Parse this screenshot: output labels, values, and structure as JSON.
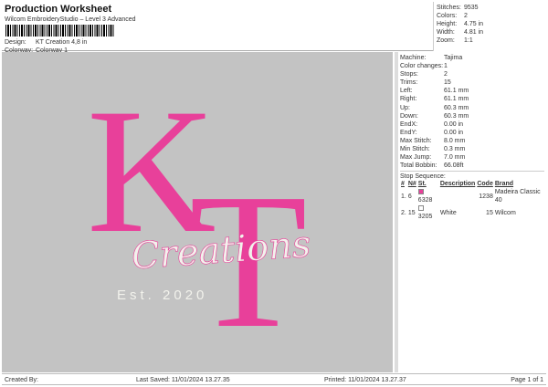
{
  "header": {
    "title": "Production Worksheet",
    "subtitle": "Wilcom EmbroideryStudio – Level 3 Advanced",
    "design_label": "Design:",
    "design": "KT Creation 4,8 in",
    "colorway_label": "Colorway:",
    "colorway": "Colorway 1"
  },
  "stats": [
    {
      "k": "Stitches:",
      "v": "9535"
    },
    {
      "k": "Colors:",
      "v": "2"
    },
    {
      "k": "Height:",
      "v": "4.75 in"
    },
    {
      "k": "Width:",
      "v": "4.81 in"
    },
    {
      "k": "Zoom:",
      "v": "1:1"
    }
  ],
  "design_art": {
    "initials_k": "K",
    "initials_t": "T",
    "script": "Creations",
    "est": "Est. 2020",
    "colors": {
      "pink": "#e8409a",
      "white": "#f2f2ec",
      "background": "#c3c3c3"
    }
  },
  "info": [
    {
      "k": "Machine:",
      "v": "Tajima"
    },
    {
      "k": "Color changes:",
      "v": "1"
    },
    {
      "k": "Stops:",
      "v": "2"
    },
    {
      "k": "Trims:",
      "v": "15"
    },
    {
      "k": "Left:",
      "v": "61.1 mm"
    },
    {
      "k": "Right:",
      "v": "61.1 mm"
    },
    {
      "k": "Up:",
      "v": "60.3 mm"
    },
    {
      "k": "Down:",
      "v": "60.3 mm"
    },
    {
      "k": "EndX:",
      "v": "0.00 in"
    },
    {
      "k": "EndY:",
      "v": "0.00 in"
    },
    {
      "k": "Max Stitch:",
      "v": "8.0 mm"
    },
    {
      "k": "Min Stitch:",
      "v": "0.3 mm"
    },
    {
      "k": "Max Jump:",
      "v": "7.0 mm"
    },
    {
      "k": "Total Bobbin:",
      "v": "66.08ft"
    }
  ],
  "stop_sequence": {
    "label": "Stop Sequence:",
    "columns": [
      "#",
      "N#",
      "St.",
      "Description",
      "Code",
      "Brand"
    ],
    "rows": [
      {
        "n": "1.",
        "needle": "6",
        "color": "#e8409a",
        "st": "6328",
        "desc": "",
        "code": "1238",
        "brand": "Madeira Classic 40"
      },
      {
        "n": "2.",
        "needle": "15",
        "color": "#ffffff",
        "st": "3205",
        "desc": "White",
        "code": "15",
        "brand": "Wilcom"
      }
    ]
  },
  "footer": {
    "created": "Created By:",
    "saved": "Last Saved: 11/01/2024 13.27.35",
    "printed": "Printed: 11/01/2024 13.27.37",
    "page": "Page 1 of 1"
  }
}
